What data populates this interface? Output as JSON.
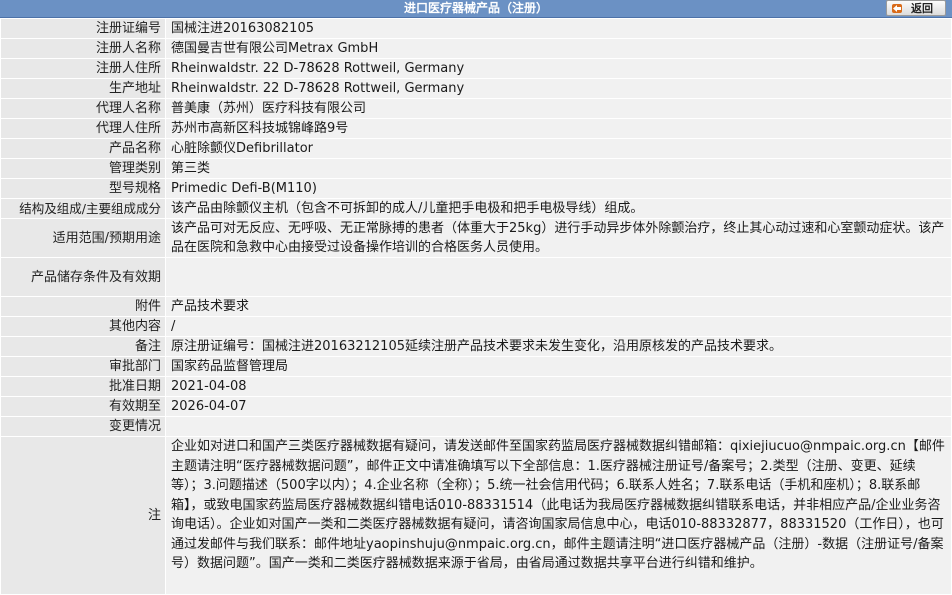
{
  "header": {
    "title": "进口医疗器械产品（注册）",
    "back_label": "返回"
  },
  "rows": [
    {
      "label": "注册证编号",
      "value": "国械注进20163082105"
    },
    {
      "label": "注册人名称",
      "value": "德国曼吉世有限公司Metrax GmbH"
    },
    {
      "label": "注册人住所",
      "value": "Rheinwaldstr. 22 D-78628 Rottweil, Germany"
    },
    {
      "label": "生产地址",
      "value": "Rheinwaldstr. 22 D-78628 Rottweil, Germany"
    },
    {
      "label": "代理人名称",
      "value": "普美康（苏州）医疗科技有限公司"
    },
    {
      "label": "代理人住所",
      "value": "苏州市高新区科技城锦峰路9号"
    },
    {
      "label": "产品名称",
      "value": "心脏除颤仪Defibrillator"
    },
    {
      "label": "管理类别",
      "value": "第三类"
    },
    {
      "label": "型号规格",
      "value": "Primedic Defi-B(M110)"
    },
    {
      "label": "结构及组成/主要组成成分",
      "value": "该产品由除颤仪主机（包含不可拆卸的成人/儿童把手电极和把手电极导线）组成。"
    },
    {
      "label": "适用范围/预期用途",
      "value": "该产品可对无反应、无呼吸、无正常脉搏的患者（体重大于25kg）进行手动异步体外除颤治疗，终止其心动过速和心室颤动症状。该产品在医院和急救中心由接受过设备操作培训的合格医务人员使用。"
    },
    {
      "label": "产品储存条件及有效期",
      "value": ""
    },
    {
      "label": "附件",
      "value": "产品技术要求"
    },
    {
      "label": "其他内容",
      "value": "/"
    },
    {
      "label": "备注",
      "value": "原注册证编号：国械注进20163212105延续注册产品技术要求未发生变化，沿用原核发的产品技术要求。"
    },
    {
      "label": "审批部门",
      "value": "国家药品监督管理局"
    },
    {
      "label": "批准日期",
      "value": "2021-04-08"
    },
    {
      "label": "有效期至",
      "value": "2026-04-07"
    },
    {
      "label": "变更情况",
      "value": ""
    },
    {
      "label": "注",
      "value": "企业如对进口和国产三类医疗器械数据有疑问，请发送邮件至国家药监局医疗器械数据纠错邮箱：qixiejiucuo@nmpaic.org.cn【邮件主题请注明“医疗器械数据问题”，邮件正文中请准确填写以下全部信息：1.医疗器械注册证号/备案号；2.类型（注册、变更、延续等）；3.问题描述（500字以内）；4.企业名称（全称）；5.统一社会信用代码；6.联系人姓名；7.联系电话（手机和座机）；8.联系邮箱】，或致电国家药监局医疗器械数据纠错电话010-88331514（此电话为我局医疗器械数据纠错联系电话，并非相应产品/企业业务咨询电话）。企业如对国产一类和二类医疗器械数据有疑问，请咨询国家局信息中心，电话010-88332877，88331520（工作日），也可通过发邮件与我们联系：邮件地址yaopinshuju@nmpaic.org.cn，邮件主题请注明“进口医疗器械产品（注册）-数据（注册证号/备案号）数据问题”。国产一类和二类医疗器械数据来源于省局，由省局通过数据共享平台进行纠错和维护。"
    }
  ]
}
